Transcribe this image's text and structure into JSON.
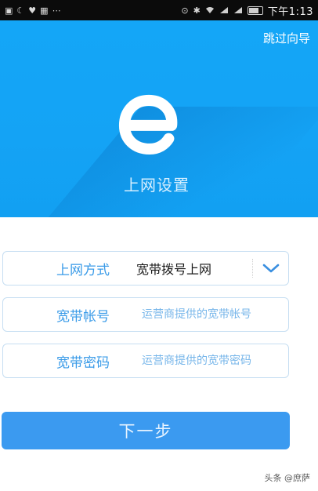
{
  "status_bar": {
    "time": "下午1:13",
    "left_icons": [
      "app-icon",
      "settings-icon",
      "heart-icon",
      "photo-icon",
      "dots-icon"
    ],
    "right_icons": [
      "location-icon",
      "alarm-icon",
      "wifi-icon",
      "signal-icon",
      "signal-icon",
      "battery-icon"
    ]
  },
  "header": {
    "skip_label": "跳过向导",
    "logo_letter": "e",
    "title": "上网设置"
  },
  "form": {
    "connection_type": {
      "label": "上网方式",
      "value": "宽带拨号上网"
    },
    "account": {
      "label": "宽带帐号",
      "placeholder": "运营商提供的宽带帐号"
    },
    "password": {
      "label": "宽带密码",
      "placeholder": "运营商提供的宽带密码"
    }
  },
  "actions": {
    "next_label": "下一步"
  },
  "watermark": "头条 @庶萨",
  "colors": {
    "banner": "#14a6f7",
    "label": "#3a9be8",
    "button": "#3b9af0"
  }
}
